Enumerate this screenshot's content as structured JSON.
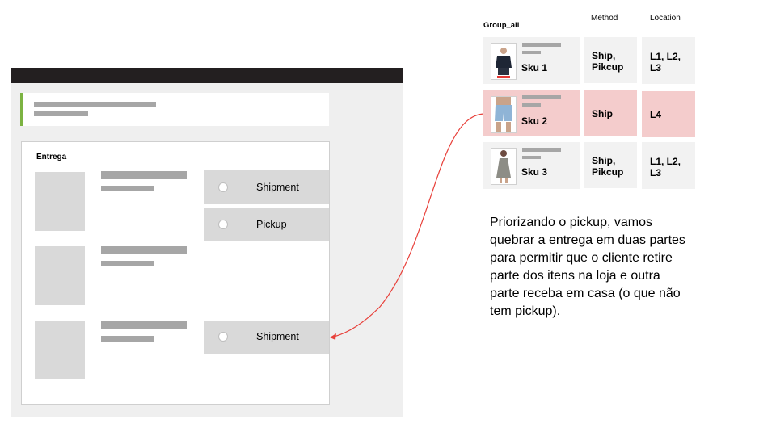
{
  "checkout": {
    "section_title": "Entrega",
    "options": [
      {
        "label": "Shipment"
      },
      {
        "label": "Pickup"
      },
      {
        "label": "Shipment"
      }
    ]
  },
  "table": {
    "group_label": "Group_all",
    "headers": {
      "method": "Method",
      "location": "Location"
    },
    "rows": [
      {
        "sku": "Sku 1",
        "method": "Ship,\nPikcup",
        "location": "L1, L2,\nL3",
        "highlight": false
      },
      {
        "sku": "Sku 2",
        "method": "Ship",
        "location": "L4",
        "highlight": true
      },
      {
        "sku": "Sku 3",
        "method": "Ship,\nPikcup",
        "location": "L1, L2,\nL3",
        "highlight": false
      }
    ]
  },
  "annotation": {
    "text": "Priorizando o pickup, vamos quebrar a entrega em duas partes para permitir que o cliente retire parte dos itens na loja e outra parte receba em casa (o que não tem pickup)."
  },
  "colors": {
    "highlight": "#f4cccc",
    "arrow": "#e8413b",
    "accent": "#7cb342"
  }
}
